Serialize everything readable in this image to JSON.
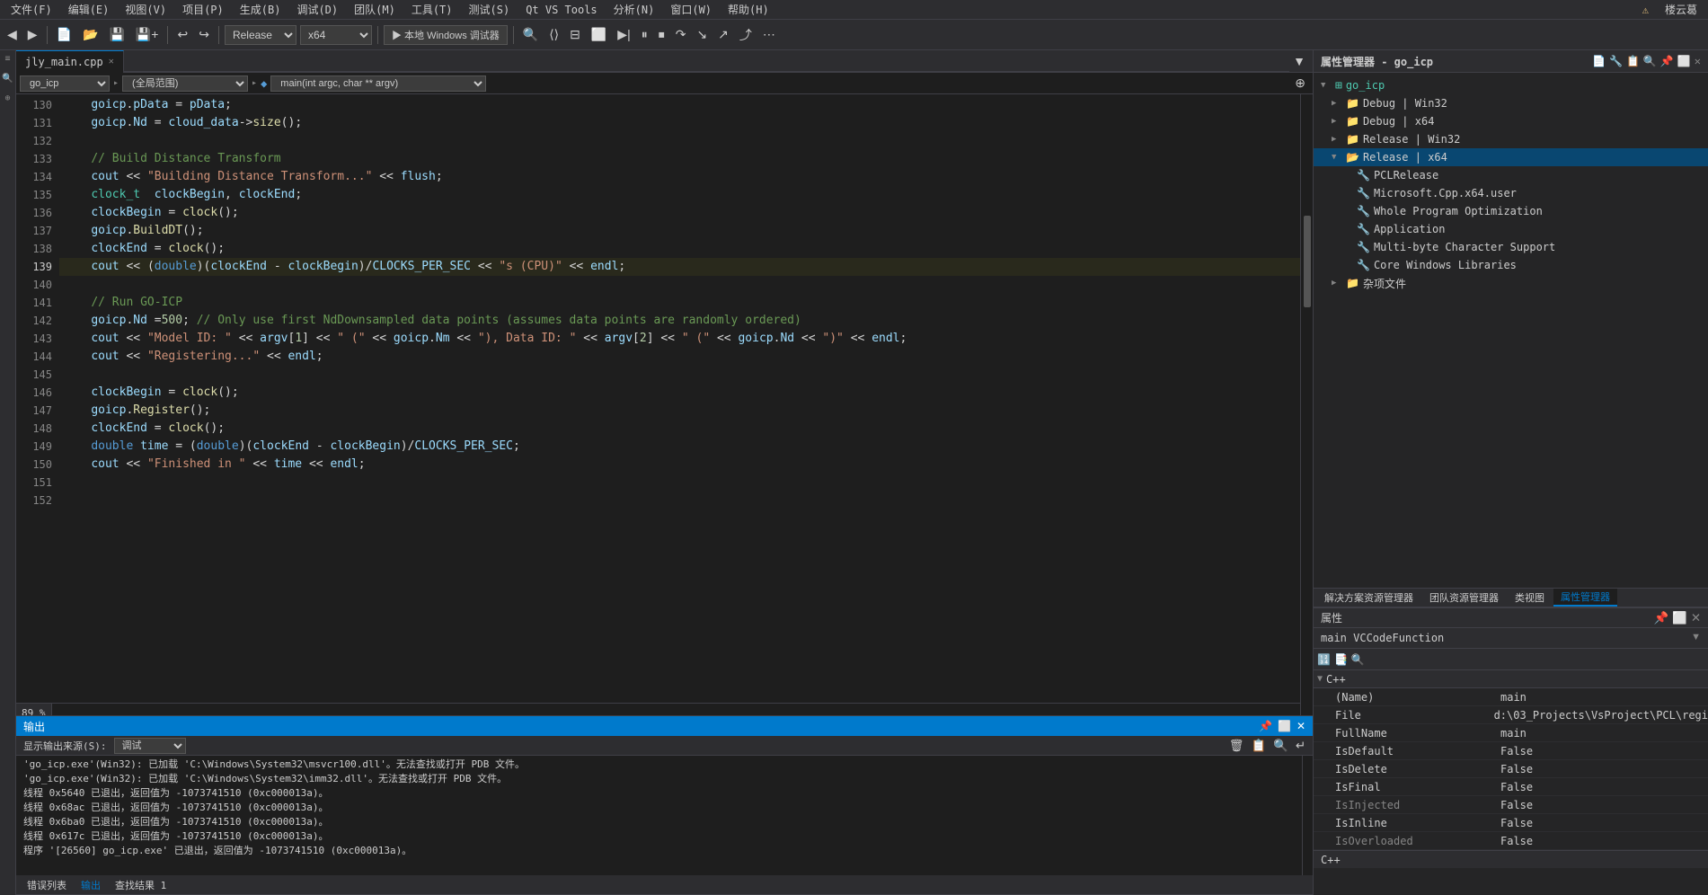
{
  "menubar": {
    "items": [
      "文件(F)",
      "编辑(E)",
      "视图(V)",
      "项目(P)",
      "生成(B)",
      "调试(D)",
      "团队(M)",
      "工具(T)",
      "测试(S)",
      "Qt VS Tools",
      "分析(N)",
      "窗口(W)",
      "帮助(H)"
    ]
  },
  "toolbar": {
    "config": "Release",
    "platform": "x64",
    "run_label": "▶ 本地 Windows 调试器",
    "warning_label": "⚠",
    "username": "楼云葛"
  },
  "tab": {
    "filename": "jly_main.cpp",
    "close": "✕"
  },
  "codenav": {
    "scope": "(全局范围)",
    "function": "main(int argc, char ** argv)"
  },
  "code_lines": [
    {
      "num": 130,
      "content": "    goicp.pData = pData;"
    },
    {
      "num": 131,
      "content": "    goicp.Nd = cloud_data->size();"
    },
    {
      "num": 132,
      "content": ""
    },
    {
      "num": 133,
      "content": "    // Build Distance Transform"
    },
    {
      "num": 134,
      "content": "    cout << \"Building Distance Transform...\" << flush;"
    },
    {
      "num": 135,
      "content": "    clock_t  clockBegin, clockEnd;"
    },
    {
      "num": 136,
      "content": "    clockBegin = clock();"
    },
    {
      "num": 137,
      "content": "    goicp.BuildDT();"
    },
    {
      "num": 138,
      "content": "    clockEnd = clock();"
    },
    {
      "num": 139,
      "content": "    cout << (double)(clockEnd - clockBegin)/CLOCKS_PER_SEC << \"s (CPU)\" << endl;"
    },
    {
      "num": 140,
      "content": ""
    },
    {
      "num": 141,
      "content": "    // Run GO-ICP"
    },
    {
      "num": 142,
      "content": "    goicp.Nd =500; // Only use first NdDownsampled data points (assumes data points are randomly ordered)"
    },
    {
      "num": 143,
      "content": "    cout << \"Model ID: \" << argv[1] << \" (\" << goicp.Nm << \"), Data ID: \" << argv[2] << \" (\" << goicp.Nd << \")\" << endl;"
    },
    {
      "num": 144,
      "content": "    cout << \"Registering...\" << endl;"
    },
    {
      "num": 145,
      "content": ""
    },
    {
      "num": 146,
      "content": "    clockBegin = clock();"
    },
    {
      "num": 147,
      "content": "    goicp.Register();"
    },
    {
      "num": 148,
      "content": "    clockEnd = clock();"
    },
    {
      "num": 149,
      "content": "    double time = (double)(clockEnd - clockBegin)/CLOCKS_PER_SEC;"
    },
    {
      "num": 150,
      "content": "    cout << \"Finished in \" << time << endl;"
    },
    {
      "num": 151,
      "content": ""
    },
    {
      "num": 152,
      "content": ""
    }
  ],
  "right_panel": {
    "title": "属性管理器 - go_icp",
    "tree_root": "go_icp",
    "tree_items": [
      {
        "label": "Debug | Win32",
        "indent": 2,
        "icon": "📁",
        "arrow": "▶",
        "type": "folder"
      },
      {
        "label": "Debug | x64",
        "indent": 2,
        "icon": "📁",
        "arrow": "▶",
        "type": "folder"
      },
      {
        "label": "Release | Win32",
        "indent": 2,
        "icon": "📁",
        "arrow": "▶",
        "type": "folder"
      },
      {
        "label": "Release | x64",
        "indent": 2,
        "icon": "📁",
        "arrow": "▼",
        "type": "folder",
        "expanded": true,
        "selected": true
      },
      {
        "label": "PCLRelease",
        "indent": 3,
        "icon": "🔧",
        "type": "item"
      },
      {
        "label": "Microsoft.Cpp.x64.user",
        "indent": 3,
        "icon": "🔧",
        "type": "item"
      },
      {
        "label": "Whole Program Optimization",
        "indent": 3,
        "icon": "🔧",
        "type": "item"
      },
      {
        "label": "Application",
        "indent": 3,
        "icon": "🔧",
        "type": "item"
      },
      {
        "label": "Multi-byte Character Support",
        "indent": 3,
        "icon": "🔧",
        "type": "item"
      },
      {
        "label": "Core Windows Libraries",
        "indent": 3,
        "icon": "🔧",
        "type": "item"
      },
      {
        "label": "杂项文件",
        "indent": 2,
        "icon": "📁",
        "arrow": "▶",
        "type": "folder"
      }
    ],
    "bottom_tabs": [
      "解决方案资源管理器",
      "团队资源管理器",
      "类视图",
      "属性管理器"
    ],
    "active_bottom_tab": "属性管理器",
    "prop_title": "属性",
    "prop_subtitle": "main VCCodeFunction",
    "prop_section": "C++",
    "prop_rows": [
      {
        "name": "(Name)",
        "value": "main"
      },
      {
        "name": "File",
        "value": "d:\\03_Projects\\VsProject\\PCL\\regi"
      },
      {
        "name": "FullName",
        "value": "main"
      },
      {
        "name": "IsDefault",
        "value": "False"
      },
      {
        "name": "IsDelete",
        "value": "False"
      },
      {
        "name": "IsFinal",
        "value": "False"
      },
      {
        "name": "IsInjected",
        "value": "False",
        "disabled": true
      },
      {
        "name": "IsInline",
        "value": "False"
      },
      {
        "name": "IsOverloaded",
        "value": "False",
        "disabled": true
      }
    ],
    "prop_bottom_section": "C++"
  },
  "output_panel": {
    "title": "输出",
    "source_label": "显示输出来源(S):",
    "source_value": "调试",
    "tabs": [
      "错误列表",
      "输出",
      "查找结果 1"
    ],
    "active_tab": "输出",
    "lines": [
      "'go_icp.exe'(Win32): 已加载 'C:\\Windows\\System32\\msvcr100.dll'。无法查找或打开 PDB 文件。",
      "'go_icp.exe'(Win32): 已加载 'C:\\Windows\\System32\\imm32.dll'。无法查找或打开 PDB 文件。",
      "线程 0x5640 已退出，返回值为 -1073741510 (0xc000013a)。",
      "线程 0x68ac 已退出，返回值为 -1073741510 (0xc000013a)。",
      "线程 0x6ba0 已退出，返回值为 -1073741510 (0xc000013a)。",
      "线程 0x617c 已退出，返回值为 -1073741510 (0xc000013a)。",
      "程序 '[26560] go_icp.exe' 已退出，返回值为 -1073741510 (0xc000013a)。"
    ]
  },
  "status_bar": {
    "zoom": "89 %",
    "items": [
      "错误列表",
      "输出",
      "查找结果 1"
    ]
  }
}
